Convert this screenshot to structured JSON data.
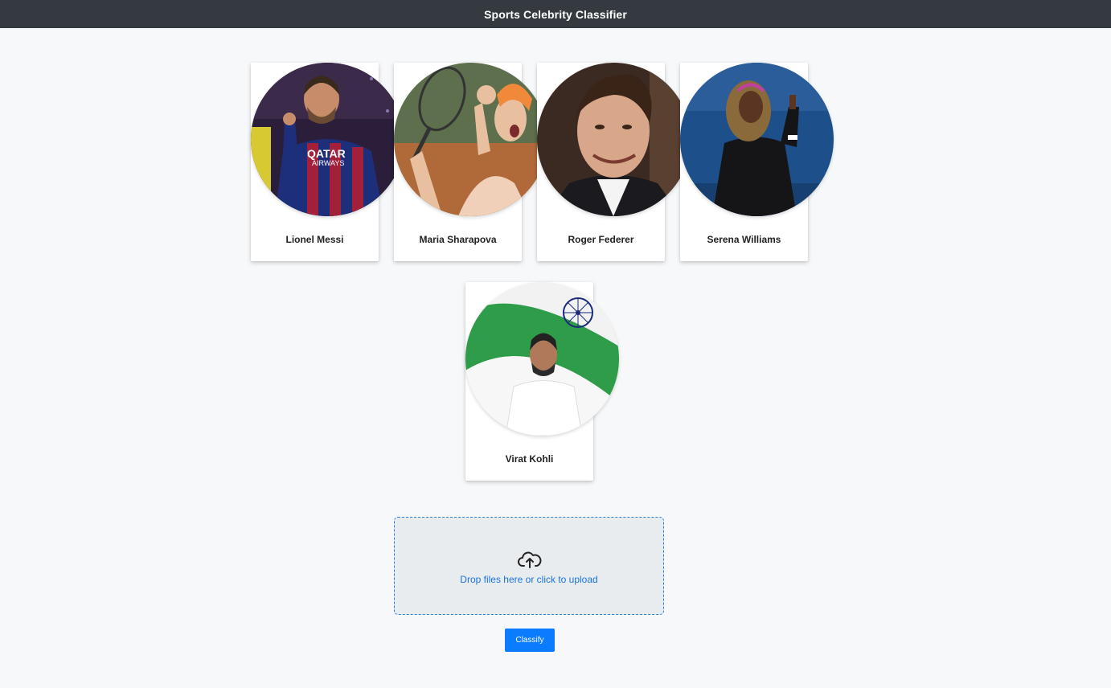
{
  "app": {
    "title": "Sports Celebrity Classifier"
  },
  "celebrities": [
    {
      "name": "Lionel Messi",
      "photo_icon": "messi-photo"
    },
    {
      "name": "Maria Sharapova",
      "photo_icon": "sharapova-photo"
    },
    {
      "name": "Roger Federer",
      "photo_icon": "federer-photo"
    },
    {
      "name": "Serena Williams",
      "photo_icon": "serena-photo"
    },
    {
      "name": "Virat Kohli",
      "photo_icon": "kohli-photo"
    }
  ],
  "upload": {
    "message": "Drop files here or click to upload",
    "icon": "cloud-upload-icon"
  },
  "actions": {
    "classify_label": "Classify"
  },
  "colors": {
    "navbar": "#343a40",
    "accent": "#0b7bff",
    "dropzone_border": "#2a7fd4",
    "dropzone_bg": "#e9ecef"
  }
}
